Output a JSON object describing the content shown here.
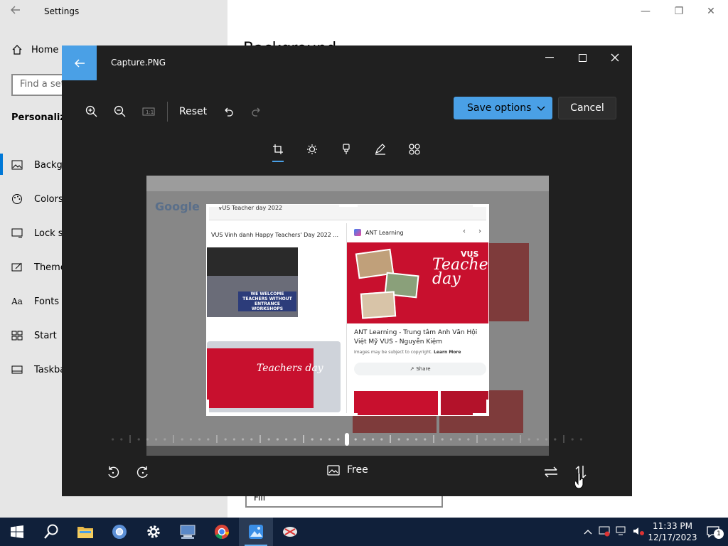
{
  "settings": {
    "title": "Settings",
    "home_label": "Home",
    "search_placeholder": "Find a setting",
    "section": "Personalization",
    "heading": "Background",
    "nav": [
      {
        "label": "Background",
        "icon": "picture-icon"
      },
      {
        "label": "Colors",
        "icon": "palette-icon"
      },
      {
        "label": "Lock screen",
        "icon": "lock-screen-icon"
      },
      {
        "label": "Themes",
        "icon": "themes-icon"
      },
      {
        "label": "Fonts",
        "icon": "fonts-icon"
      },
      {
        "label": "Start",
        "icon": "start-icon"
      },
      {
        "label": "Taskbar",
        "icon": "taskbar-icon"
      }
    ],
    "fit_select": "Fill"
  },
  "editor": {
    "filename": "Capture.PNG",
    "reset_label": "Reset",
    "save_label": "Save options",
    "cancel_label": "Cancel",
    "aspect_label": "Free",
    "tabs": [
      "crop",
      "adjust",
      "filter",
      "markup",
      "retouch"
    ],
    "accent": "#4aa0e6"
  },
  "captured_image": {
    "header_text": "VUS Teacher day 2022",
    "caption_1": "VUS Vinh danh Happy Teachers' Day 2022 ...",
    "video_label": "WE WELCOME TEACHERS WITHOUT ENTRANCE WORKSHOPS",
    "panel_source": "ANT Learning",
    "panel_title": "ANT Learning - Trung tâm Anh Văn Hội Việt Mỹ VUS - Nguyễn Kiệm",
    "panel_copyright": "Images may be subject to copyright.",
    "learn_more": "Learn More",
    "share_label": "Share",
    "teachers_day_text": "Teachers day",
    "vus_logo": "VUS",
    "google_logo": "Google"
  },
  "taskbar": {
    "time": "11:33 PM",
    "date": "12/17/2023",
    "notification_count": "1",
    "background": "#10203a"
  }
}
